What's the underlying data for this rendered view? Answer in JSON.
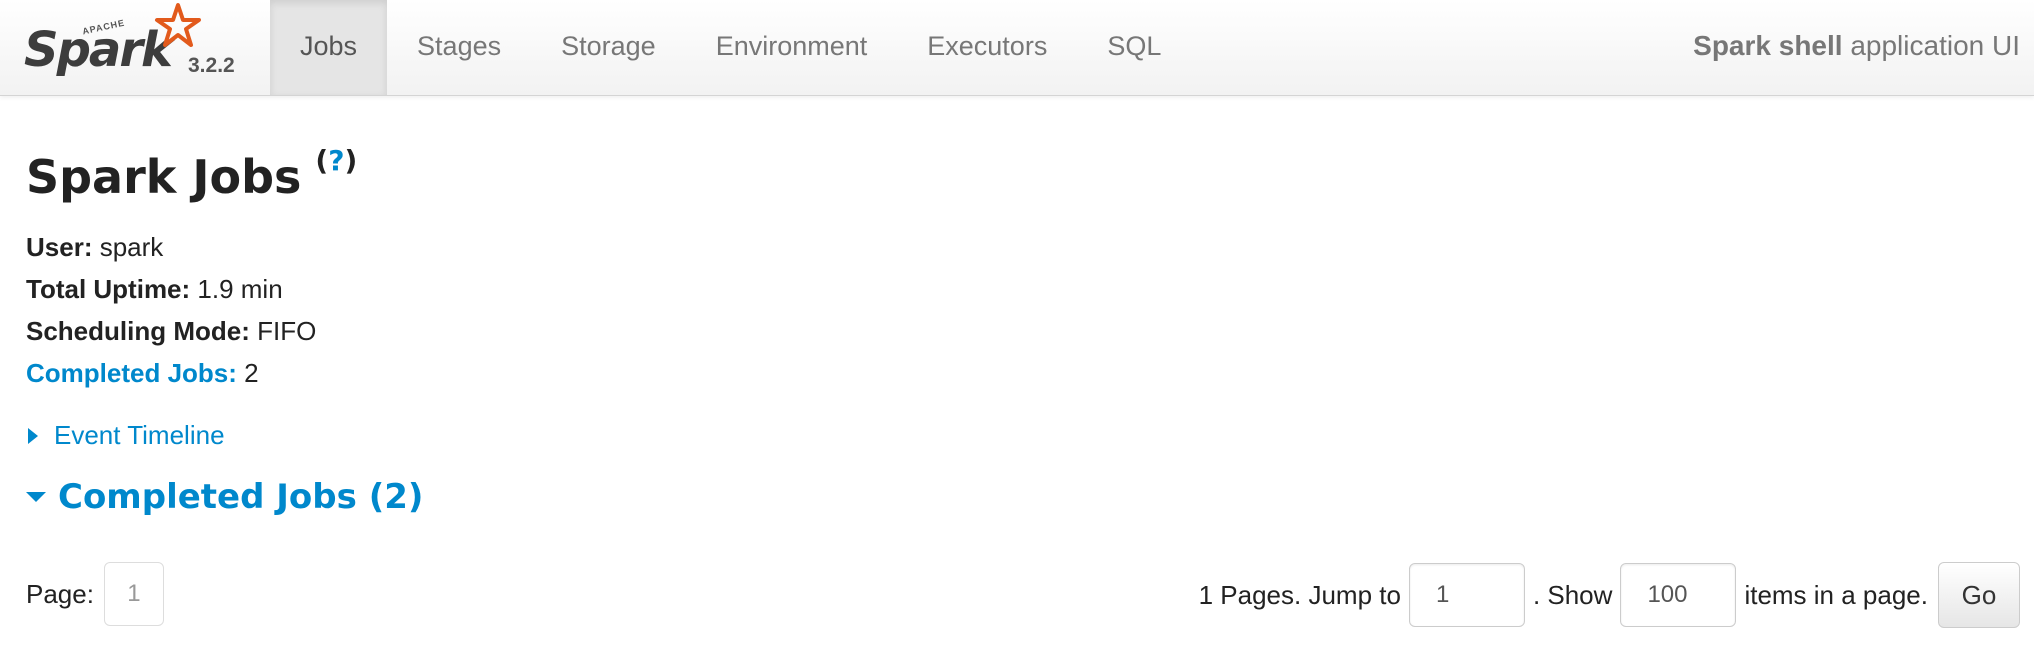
{
  "brand": {
    "logo_small": "APACHE",
    "logo_word": "Spark",
    "version": "3.2.2"
  },
  "nav": {
    "tabs": [
      {
        "label": "Jobs",
        "active": true
      },
      {
        "label": "Stages"
      },
      {
        "label": "Storage"
      },
      {
        "label": "Environment"
      },
      {
        "label": "Executors"
      },
      {
        "label": "SQL"
      }
    ],
    "app_name": "Spark shell",
    "app_suffix": " application UI"
  },
  "page": {
    "title": "Spark Jobs",
    "help_open": "(",
    "help_q": "?",
    "help_close": ")",
    "summary": {
      "user_key": "User:",
      "user_val": " spark",
      "uptime_key": "Total Uptime:",
      "uptime_val": " 1.9 min",
      "mode_key": "Scheduling Mode:",
      "mode_val": " FIFO",
      "completed_key": "Completed Jobs:",
      "completed_val": " 2"
    },
    "event_timeline": "Event Timeline",
    "section_title": "Completed Jobs (2)"
  },
  "pager": {
    "page_label": "Page:",
    "current_page": "1",
    "pages_text": "1 Pages. Jump to",
    "jump_value": "1",
    "show_text": ". Show",
    "show_value": "100",
    "items_text": "items in a page.",
    "go_label": "Go"
  },
  "colors": {
    "link": "#0088cc",
    "nav_text": "#777777",
    "active_tab_bg": "#e5e5e5",
    "logo_orange": "#e25a1c"
  },
  "icons": {
    "logo_star": "spark-star-icon",
    "expand_collapsed": "triangle-right-icon",
    "expand_open": "triangle-down-icon"
  }
}
